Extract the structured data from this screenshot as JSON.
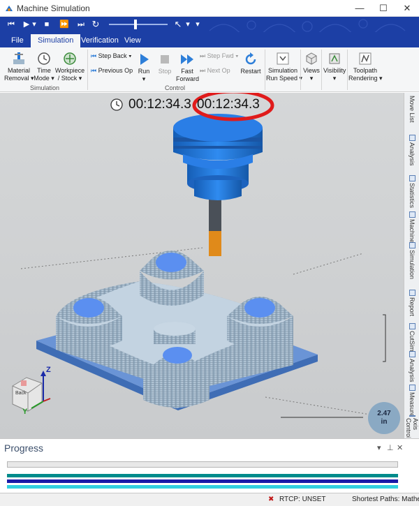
{
  "window": {
    "title": "Machine Simulation",
    "minimize_glyph": "—",
    "maximize_glyph": "☐",
    "close_glyph": "✕"
  },
  "quick_access": {
    "buttons": [
      {
        "name": "rewind-icon",
        "glyph": "⏮"
      },
      {
        "name": "play-icon",
        "glyph": "▶"
      },
      {
        "name": "dropdown-icon",
        "glyph": "▾"
      },
      {
        "name": "stop-icon",
        "glyph": "■"
      },
      {
        "name": "fast-forward-icon",
        "glyph": "⏩"
      },
      {
        "name": "skip-end-icon",
        "glyph": "⏭"
      },
      {
        "name": "restart-icon",
        "glyph": "↻"
      }
    ],
    "speed_slider_level": 0.45,
    "pointer_glyph": "↖",
    "more_glyph": "▾"
  },
  "tabs": [
    {
      "id": "file",
      "label": "File",
      "active": false
    },
    {
      "id": "simulation",
      "label": "Simulation",
      "active": true
    },
    {
      "id": "verification",
      "label": "Verification",
      "active": false
    },
    {
      "id": "view",
      "label": "View",
      "active": false
    }
  ],
  "ribbon": {
    "material_removal": "Material\nRemoval ▾",
    "time_mode": "Time\nMode ▾",
    "workpiece_stock": "Workpiece\n/ Stock ▾",
    "group_simulation": "Simulation",
    "step_back": "Step Back ▾",
    "previous_op": "Previous Op",
    "run": "Run",
    "run_arrow": "▾",
    "stop": "Stop",
    "fast_forward": "Fast\nForward",
    "step_fwd": "Step Fwd ▾",
    "next_op": "Next Op",
    "restart": "Restart",
    "group_control": "Control",
    "simulation_run_speed": "Simulation\nRun Speed ▾",
    "views": "Views",
    "views_arrow": "▾",
    "visibility": "Visibility",
    "visibility_arrow": "▾",
    "toolpath_rendering": "Toolpath\nRendering ▾"
  },
  "viewport": {
    "time_primary": "00:12:34.3",
    "time_overlay": "00:12:34.3",
    "scale_value": "2.47",
    "scale_unit": "in",
    "axis_labels": {
      "z": "Z",
      "y": "Y",
      "x": "X"
    },
    "cube_label": "Back",
    "colors": {
      "tool_holder": "#1e73d6",
      "tool_shank": "#4a5058",
      "tool_tip": "#e08a1a",
      "stock": "#9fb7cb",
      "base_plate": "#5b88c9",
      "highlight_circle": "#e01b1b",
      "boss_top": "#5b8ff0"
    }
  },
  "side_tabs": [
    {
      "label": "Move List"
    },
    {
      "label": "Analysis"
    },
    {
      "label": "Statistics"
    },
    {
      "label": "Machine"
    },
    {
      "label": "Simulation"
    },
    {
      "label": "Report"
    },
    {
      "label": "CutSim"
    },
    {
      "label": "Analysis"
    },
    {
      "label": "Measure"
    },
    {
      "label": "Axis Control"
    }
  ],
  "progress": {
    "title": "Progress",
    "pin_glyph": "▾",
    "pin2_glyph": "⊥",
    "close_glyph": "✕",
    "bar_colors": [
      "#008b8b",
      "#1a1aa8",
      "#33cfe0"
    ]
  },
  "status": {
    "error_glyph": "✖",
    "rtcp": "RTCP: UNSET",
    "shortest_paths": "Shortest Paths: Mathem..."
  }
}
